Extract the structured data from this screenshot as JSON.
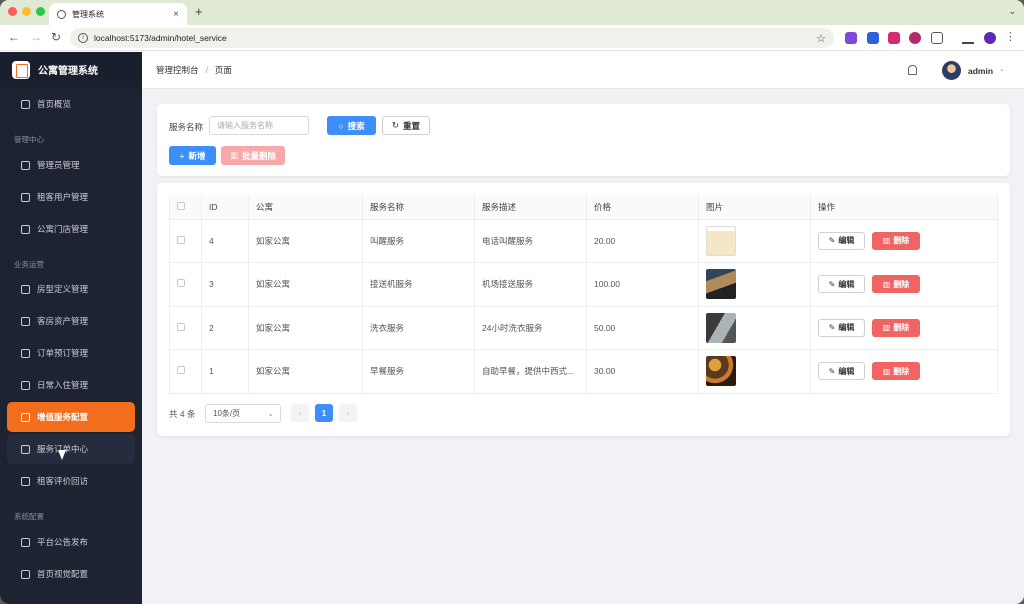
{
  "browser": {
    "tab_title": "管理系统",
    "url": "localhost:5173/admin/hotel_service"
  },
  "sidebar": {
    "brand": "公寓管理系统",
    "home": "首页概览",
    "groups": {
      "admin_center": "管理中心",
      "business": "业务运营",
      "system": "系统配置"
    },
    "items": {
      "admin_manage": "管理员管理",
      "tenant_manage": "租客用户管理",
      "store_manage": "公寓门店管理",
      "room_type": "房型定义管理",
      "room_asset": "客房资产管理",
      "order_booking": "订单预订管理",
      "checkin": "日常入住管理",
      "value_service": "增值服务配置",
      "service_order": "服务订单中心",
      "review": "租客评价回访",
      "notice": "平台公告发布",
      "home_visual": "首页视觉配置"
    }
  },
  "header": {
    "breadcrumb_root": "管理控制台",
    "breadcrumb_sep": "/",
    "breadcrumb_current": "页面",
    "username": "admin"
  },
  "search": {
    "label": "服务名称",
    "placeholder": "请输入服务名称",
    "search_btn": "搜索",
    "reset_btn": "重置",
    "add_btn": "新增",
    "batch_delete_btn": "批量删除"
  },
  "table": {
    "columns": [
      "ID",
      "公寓",
      "服务名称",
      "服务描述",
      "价格",
      "图片",
      "操作"
    ],
    "edit_label": "编辑",
    "delete_label": "删除",
    "rows": [
      {
        "id": "4",
        "apartment": "如家公寓",
        "name": "叫醒服务",
        "desc": "电话叫醒服务",
        "price": "20.00",
        "image": "t1"
      },
      {
        "id": "3",
        "apartment": "如家公寓",
        "name": "接送机服务",
        "desc": "机场接送服务",
        "price": "100.00",
        "image": "t2"
      },
      {
        "id": "2",
        "apartment": "如家公寓",
        "name": "洗衣服务",
        "desc": "24小时洗衣服务",
        "price": "50.00",
        "image": "t3"
      },
      {
        "id": "1",
        "apartment": "如家公寓",
        "name": "早餐服务",
        "desc": "自助早餐，提供中西式...",
        "price": "30.00",
        "image": "t4"
      }
    ]
  },
  "pagination": {
    "total": "共 4 条",
    "page_size": "10条/页",
    "current_page": "1",
    "prev": "‹",
    "next": "›"
  },
  "colors": {
    "accent": "#f26e1d",
    "primary": "#3d8ef8",
    "danger": "#f16464",
    "sidebar_bg": "#1e2332"
  }
}
